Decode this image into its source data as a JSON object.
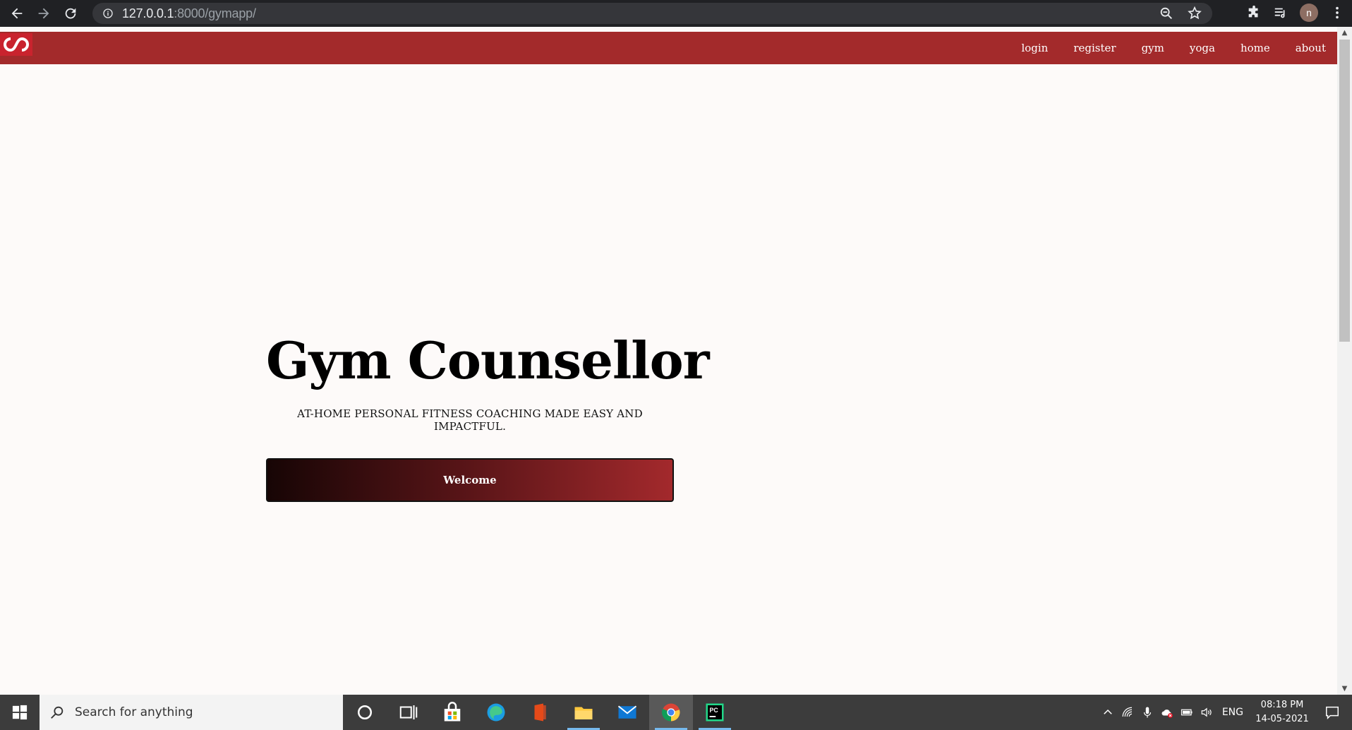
{
  "browser": {
    "url_host": "127.0.0.1",
    "url_rest": ":8000/gymapp/",
    "avatar_letter": "n"
  },
  "site": {
    "nav_links": [
      "login",
      "register",
      "gym",
      "yoga",
      "home",
      "about"
    ],
    "hero_title": "Gym Counsellor",
    "hero_subtitle": "AT-HOME PERSONAL FITNESS COACHING MADE EASY AND IMPACTFUL.",
    "welcome_label": "Welcome",
    "brand_color": "#a32a2b"
  },
  "taskbar": {
    "search_placeholder": "Search for anything",
    "language": "ENG",
    "time": "08:18 PM",
    "date": "14-05-2021"
  }
}
